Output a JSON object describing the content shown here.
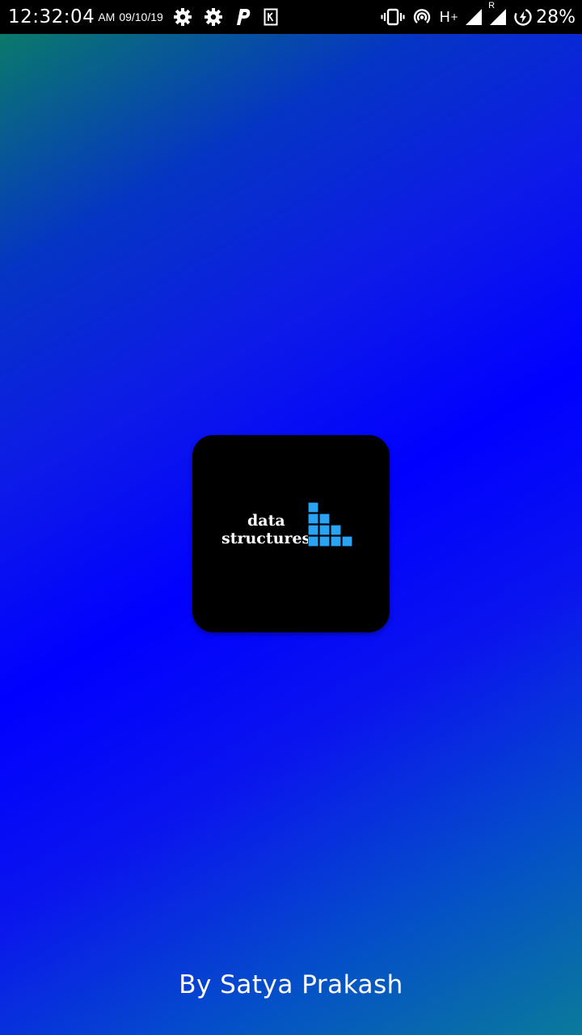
{
  "status_bar": {
    "time": "12:32:04",
    "ampm": "AM",
    "date": "09/10/19",
    "network": "H",
    "network_sup": "+",
    "roaming": "R",
    "battery": "28%",
    "icons_left": [
      "gear-icon",
      "gear-icon",
      "parking-icon",
      "k-app-icon"
    ],
    "icons_right": [
      "vibrate-icon",
      "hotspot-icon",
      "signal-icon",
      "signal-roaming-icon",
      "battery-charging-icon"
    ]
  },
  "splash": {
    "logo": {
      "word1": "data",
      "word2": "structures",
      "accent_color": "#2aa3f3",
      "card_color": "#000000"
    },
    "credit": "By Satya Prakash"
  },
  "colors": {
    "gradient_main": "#0000ff",
    "gradient_corner_top": "#0a7a6a",
    "gradient_corner_bottom": "#0a7a9a"
  }
}
